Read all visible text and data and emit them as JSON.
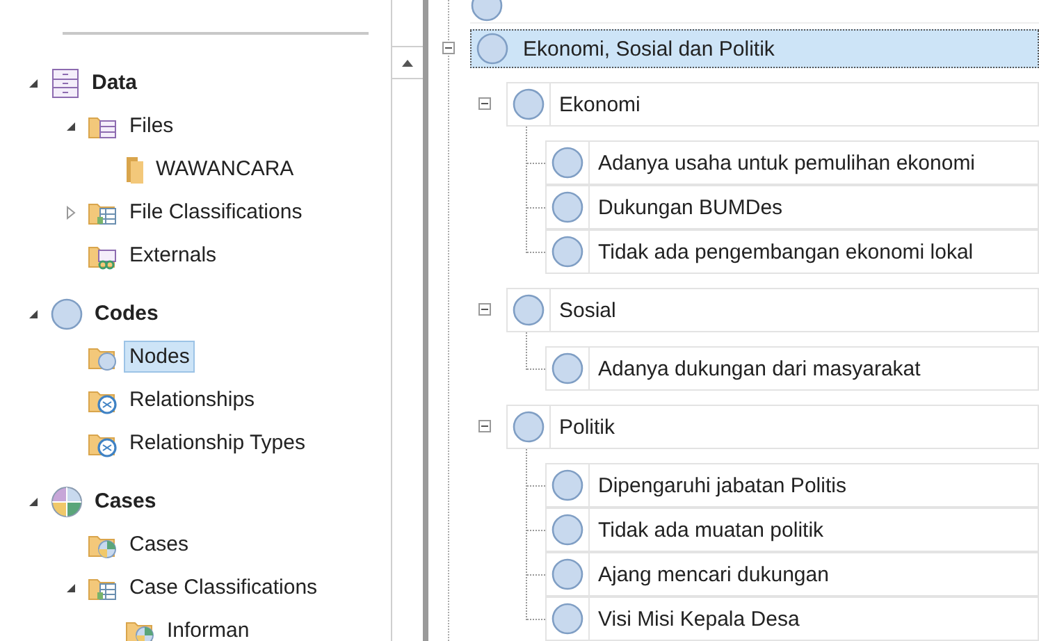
{
  "navigation": {
    "sections": [
      {
        "label": "Data",
        "kind": "data",
        "expanded": true,
        "selected": false,
        "children": [
          {
            "label": "Files",
            "kind": "files",
            "expanded": true,
            "selected": false,
            "children": [
              {
                "label": "WAWANCARA",
                "kind": "folder",
                "selected": false
              }
            ]
          },
          {
            "label": "File Classifications",
            "kind": "classes",
            "expanded": false,
            "selected": false
          },
          {
            "label": "Externals",
            "kind": "externals",
            "selected": false
          }
        ]
      },
      {
        "label": "Codes",
        "kind": "codes",
        "expanded": true,
        "selected": false,
        "children": [
          {
            "label": "Nodes",
            "kind": "nodes",
            "selected": true
          },
          {
            "label": "Relationships",
            "kind": "relationships",
            "selected": false
          },
          {
            "label": "Relationship Types",
            "kind": "relationships",
            "selected": false
          }
        ]
      },
      {
        "label": "Cases",
        "kind": "cases",
        "expanded": true,
        "selected": false,
        "children": [
          {
            "label": "Cases",
            "kind": "casefolder",
            "selected": false
          },
          {
            "label": "Case Classifications",
            "kind": "classes",
            "expanded": true,
            "selected": false,
            "children": [
              {
                "label": "Informan",
                "kind": "casefolder",
                "selected": false
              }
            ]
          }
        ]
      }
    ]
  },
  "node_tree": [
    {
      "label": "Ekonomi, Sosial dan Politik",
      "selected": true,
      "expanded": true,
      "children": [
        {
          "label": "Ekonomi",
          "selected": false,
          "expanded": true,
          "children": [
            {
              "label": "Adanya usaha untuk pemulihan ekonomi",
              "selected": false
            },
            {
              "label": "Dukungan BUMDes",
              "selected": false
            },
            {
              "label": "Tidak ada pengembangan ekonomi lokal",
              "selected": false
            }
          ]
        },
        {
          "label": "Sosial",
          "selected": false,
          "expanded": true,
          "children": [
            {
              "label": "Adanya dukungan dari masyarakat",
              "selected": false
            }
          ]
        },
        {
          "label": "Politik",
          "selected": false,
          "expanded": true,
          "children": [
            {
              "label": "Dipengaruhi jabatan Politis",
              "selected": false
            },
            {
              "label": "Tidak ada muatan politik",
              "selected": false
            },
            {
              "label": "Ajang mencari dukungan",
              "selected": false
            },
            {
              "label": "Visi Misi Kepala Desa",
              "selected": false
            }
          ]
        }
      ]
    }
  ]
}
